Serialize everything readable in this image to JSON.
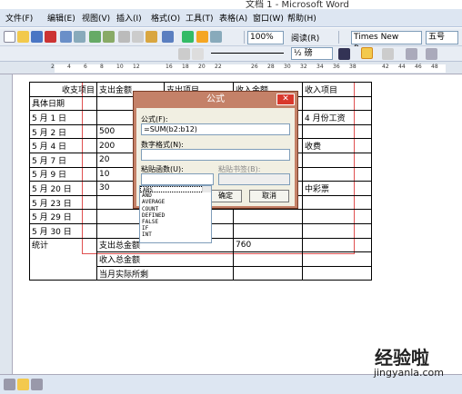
{
  "window": {
    "title": "文档 1 - Microsoft Word"
  },
  "menu": [
    "文件(F)",
    "编辑(E)",
    "视图(V)",
    "插入(I)",
    "格式(O)",
    "工具(T)",
    "表格(A)",
    "窗口(W)",
    "帮助(H)"
  ],
  "toolbar": {
    "zoom": "100%",
    "read_label": "阅读(R)",
    "font": "Times New Roman",
    "font_size": "五号",
    "line_spacing": "½ 磅"
  },
  "ruler_ticks": [
    "2",
    "4",
    "6",
    "8",
    "10",
    "12",
    "16",
    "18",
    "20",
    "22",
    "26",
    "28",
    "30",
    "32",
    "34",
    "36",
    "38",
    "42",
    "44",
    "46",
    "48"
  ],
  "table": {
    "header": [
      "收支项目",
      "支出金额",
      "支出项目",
      "收入金额",
      "收入项目"
    ],
    "header_sub": "具体日期",
    "rows": [
      [
        "5 月 1 日",
        "",
        "",
        "",
        "4 月份工资"
      ],
      [
        "5 月 2 日",
        "500",
        "",
        "",
        ""
      ],
      [
        "5 月 4 日",
        "200",
        "",
        "",
        "收费"
      ],
      [
        "5 月 7 日",
        "20",
        "",
        "",
        ""
      ],
      [
        "5 月 9 日",
        "10",
        "",
        "",
        ""
      ],
      [
        "5 月 20 日",
        "30",
        "",
        "",
        "中彩票"
      ],
      [
        "5 月 23 日",
        "",
        "",
        "",
        ""
      ],
      [
        "5 月 29 日",
        "",
        "",
        "",
        ""
      ],
      [
        "5 月 30 日",
        "",
        "",
        "",
        ""
      ]
    ],
    "stats_label": "统计",
    "total_expense": "支出总金额",
    "total_income": "收入总金额",
    "income_value": "760",
    "actual": "当月实际所剩"
  },
  "dialog": {
    "title": "公式",
    "formula_label": "公式(F):",
    "formula_value": "=SUM(b2:b12)",
    "number_format_label": "数字格式(N):",
    "paste_function_label": "粘贴函数(U):",
    "paste_bookmark_label": "粘贴书签(B):",
    "ok": "确定",
    "cancel": "取消",
    "functions": [
      "ABS",
      "AND",
      "AVERAGE",
      "COUNT",
      "DEFINED",
      "FALSE",
      "IF",
      "INT"
    ]
  },
  "watermark": {
    "line1": "经验啦",
    "line2": "jingyanla.com"
  }
}
